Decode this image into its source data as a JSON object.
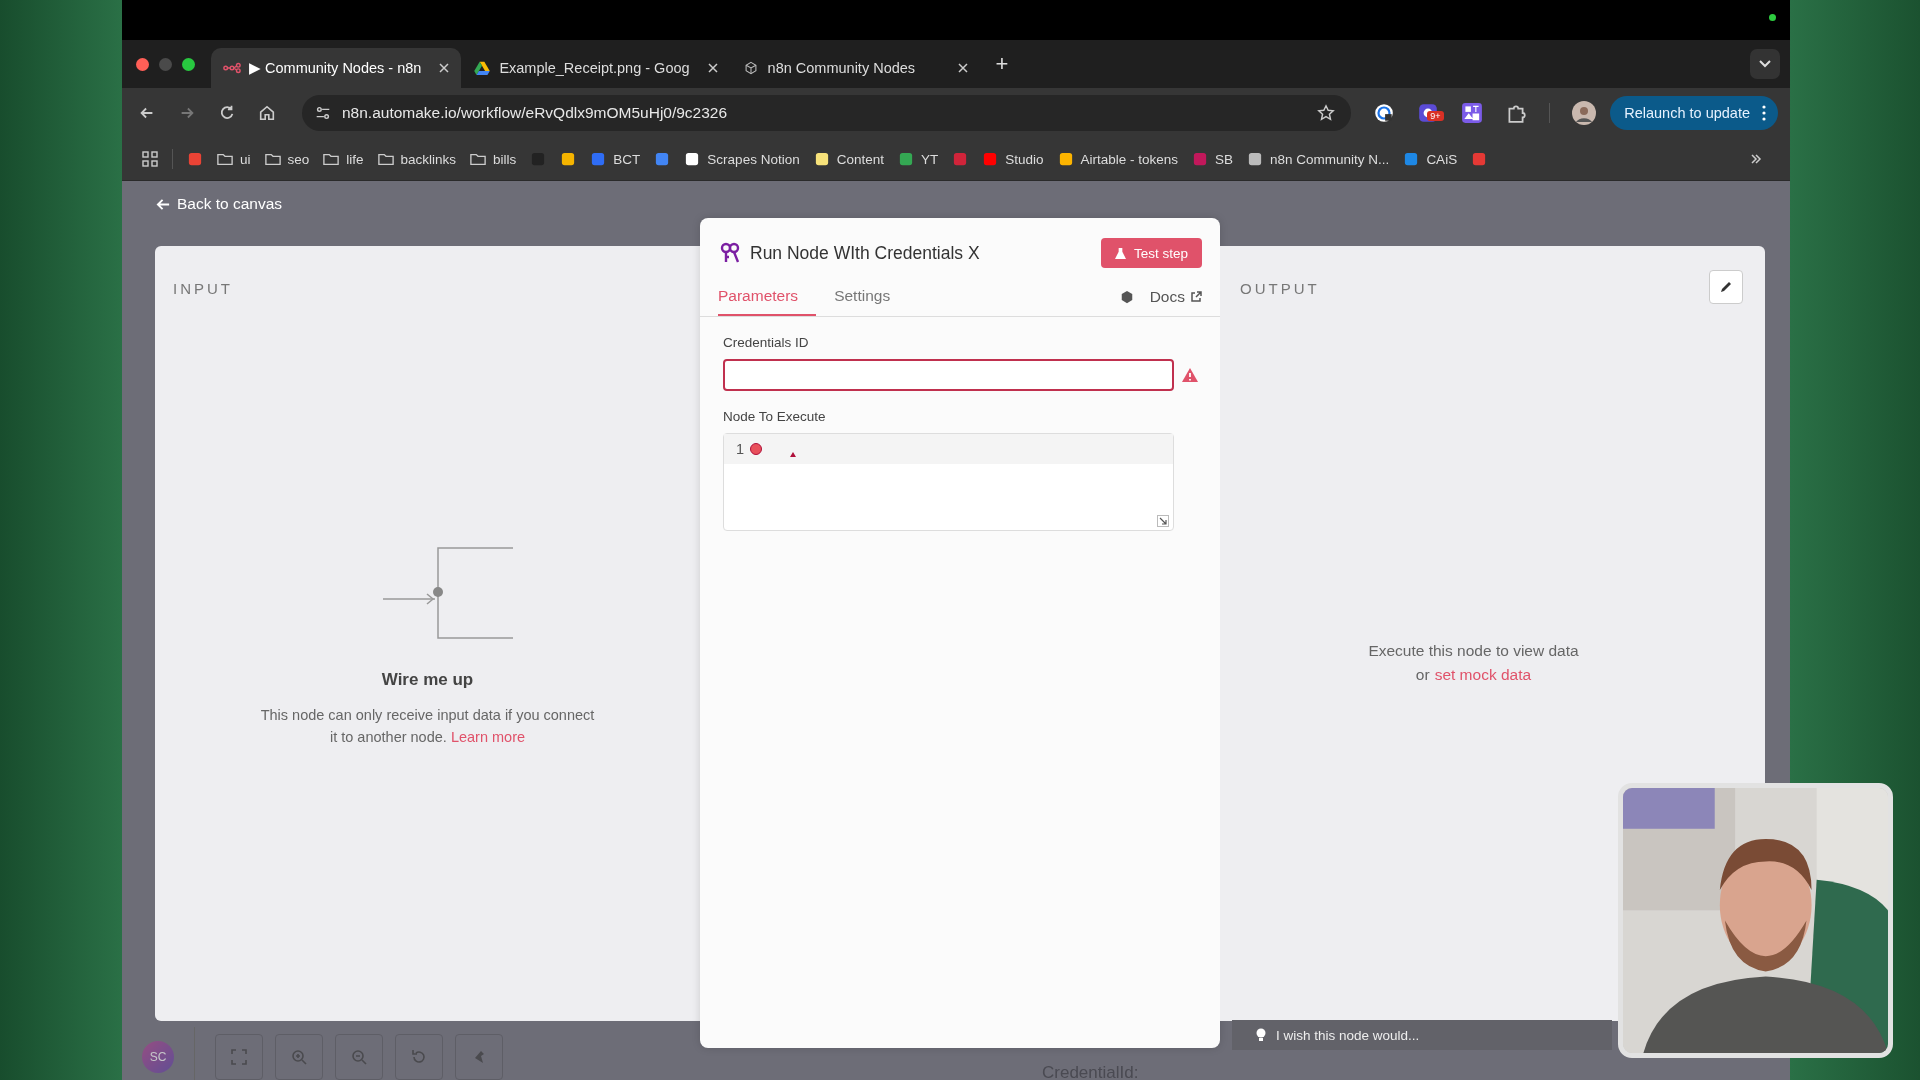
{
  "browser": {
    "tabs": [
      {
        "title": "▶ Community Nodes - n8n",
        "kind": "nodes",
        "selected": true
      },
      {
        "title": "Example_Receipt.png - Goog",
        "kind": "drive",
        "selected": false
      },
      {
        "title": "n8n Community Nodes",
        "kind": "cube",
        "selected": false
      }
    ],
    "new_tab": "+",
    "url": "n8n.automake.io/workflow/eRvQdlx9mOM5uHj0/9c2326",
    "extension_badge": "9+",
    "relaunch_button": "Relaunch to update",
    "bookmarks": [
      {
        "kind": "site",
        "color": "#ea4335"
      },
      {
        "kind": "folder",
        "label": "ui"
      },
      {
        "kind": "folder",
        "label": "seo"
      },
      {
        "kind": "folder",
        "label": "life"
      },
      {
        "kind": "folder",
        "label": "backlinks"
      },
      {
        "kind": "folder",
        "label": "bills"
      },
      {
        "kind": "site",
        "color": "#222222"
      },
      {
        "kind": "site",
        "color": "#f5b400"
      },
      {
        "kind": "site",
        "label": "BCT",
        "color": "#2f6df6"
      },
      {
        "kind": "site",
        "color": "#4285f4"
      },
      {
        "kind": "site",
        "label": "Scrapes Notion",
        "color": "#ffffff"
      },
      {
        "kind": "site",
        "label": "Content",
        "color": "#f7e27a"
      },
      {
        "kind": "site",
        "label": "YT",
        "color": "#34a853"
      },
      {
        "kind": "site",
        "color": "#d0243a"
      },
      {
        "kind": "site",
        "label": "Studio",
        "color": "#ff0000"
      },
      {
        "kind": "site",
        "label": "Airtable - tokens",
        "color": "#fcb400"
      },
      {
        "kind": "site",
        "label": "SB",
        "color": "#c2185b"
      },
      {
        "kind": "site",
        "label": "n8n Community N...",
        "color": "#bbbbbb"
      },
      {
        "kind": "site",
        "label": "CAiS",
        "color": "#1e88e5"
      },
      {
        "kind": "site",
        "color": "#e53935"
      }
    ]
  },
  "back_link": "Back to canvas",
  "input_panel": {
    "title": "INPUT",
    "heading": "Wire me up",
    "text": "This node can only receive input data if you connect it to another node.",
    "link": "Learn more"
  },
  "node_panel": {
    "title": "Run Node WIth Credentials X",
    "test_button": "Test step",
    "tabs": [
      {
        "label": "Parameters",
        "selected": true
      },
      {
        "label": "Settings",
        "selected": false
      }
    ],
    "docs_link": "Docs",
    "fields": [
      {
        "kind": "text",
        "label": "Credentials ID",
        "error": true
      },
      {
        "kind": "code",
        "label": "Node To Execute",
        "line": "1",
        "error": true
      }
    ]
  },
  "output_panel": {
    "title": "OUTPUT",
    "text": "Execute this node to view data",
    "or": "or",
    "link": "set mock data"
  },
  "feedback": "I wish this node would...",
  "canvas": {
    "avatar": "SC",
    "footer_text": "CredentialId:"
  }
}
